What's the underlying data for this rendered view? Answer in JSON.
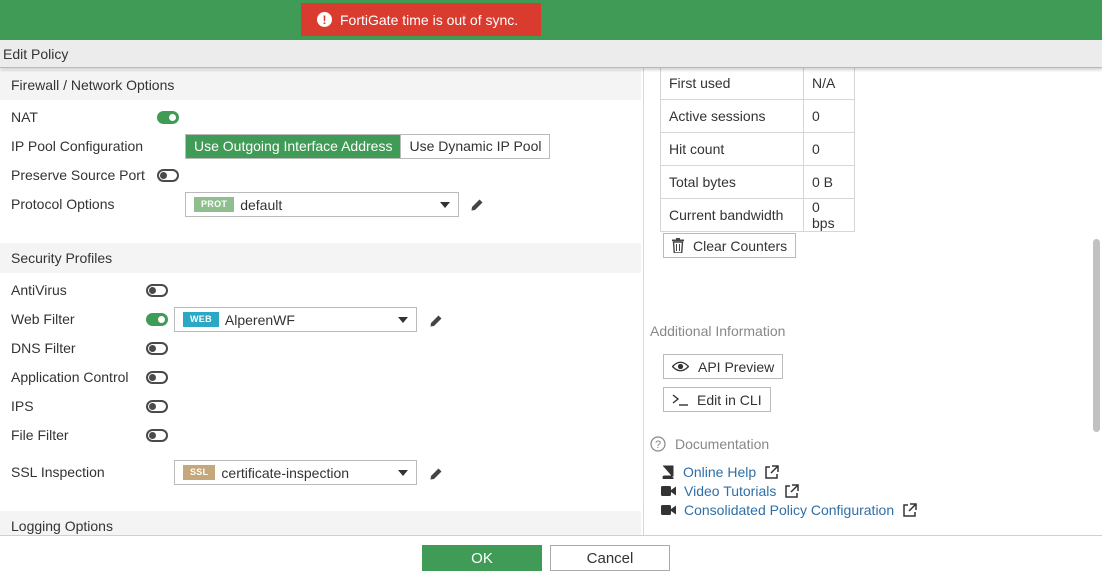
{
  "alert": {
    "message": "FortiGate time is out of sync.",
    "icon": "exclamation-circle-icon"
  },
  "window": {
    "title": "Edit Policy"
  },
  "firewall": {
    "header": "Firewall / Network Options",
    "nat_label": "NAT",
    "nat_enabled": true,
    "ip_pool_label": "IP Pool Configuration",
    "ip_pool_options": [
      "Use Outgoing Interface Address",
      "Use Dynamic IP Pool"
    ],
    "ip_pool_selected": "Use Outgoing Interface Address",
    "preserve_label": "Preserve Source Port",
    "preserve_enabled": false,
    "protocol_label": "Protocol Options",
    "protocol_tag": "PROT",
    "protocol_value": "default"
  },
  "security": {
    "header": "Security Profiles",
    "antivirus_label": "AntiVirus",
    "webfilter_label": "Web Filter",
    "webfilter_tag": "WEB",
    "webfilter_value": "AlperenWF",
    "dns_label": "DNS Filter",
    "appctrl_label": "Application Control",
    "ips_label": "IPS",
    "filefilter_label": "File Filter",
    "ssl_label": "SSL Inspection",
    "ssl_tag": "SSL",
    "ssl_value": "certificate-inspection"
  },
  "logging": {
    "header": "Logging Options"
  },
  "stats": {
    "rows": [
      {
        "label": "First used",
        "value": "N/A"
      },
      {
        "label": "Active sessions",
        "value": "0"
      },
      {
        "label": "Hit count",
        "value": "0"
      },
      {
        "label": "Total bytes",
        "value": "0 B"
      },
      {
        "label": "Current bandwidth",
        "value": "0 bps"
      }
    ],
    "clear_label": "Clear Counters"
  },
  "additional": {
    "header": "Additional Information",
    "api_preview": "API Preview",
    "edit_cli": "Edit in CLI"
  },
  "documentation": {
    "header": "Documentation",
    "links": [
      {
        "label": "Online Help",
        "icon": "book-icon"
      },
      {
        "label": "Video Tutorials",
        "icon": "video-icon"
      },
      {
        "label": "Consolidated Policy Configuration",
        "icon": "video-icon"
      }
    ]
  },
  "footer": {
    "ok": "OK",
    "cancel": "Cancel"
  },
  "colors": {
    "brand_green": "#3f9b55",
    "alert_red": "#d93c2f",
    "prot_tag": "#8fbf8f",
    "web_tag": "#2aa8c4",
    "ssl_tag": "#c4a77b",
    "link": "#2f6fa7"
  }
}
